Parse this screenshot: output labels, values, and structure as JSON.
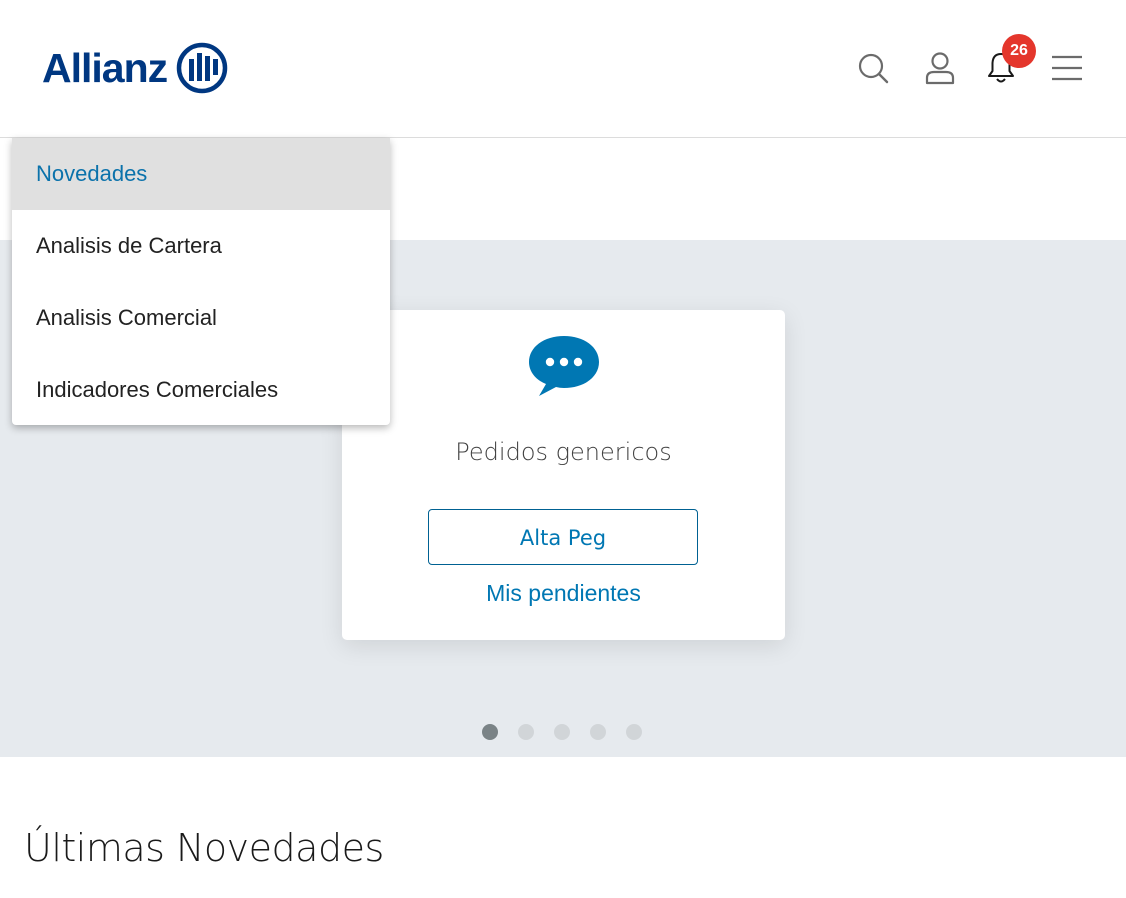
{
  "header": {
    "logo_text": "Allianz",
    "notification_count": "26",
    "icons": [
      "search-icon",
      "user-icon",
      "bell-icon",
      "hamburger-menu-icon"
    ]
  },
  "menu": {
    "items": [
      {
        "label": "Novedades",
        "selected": true
      },
      {
        "label": "Analisis de Cartera",
        "selected": false
      },
      {
        "label": "Analisis Comercial",
        "selected": false
      },
      {
        "label": "Indicadores Comerciales",
        "selected": false
      }
    ]
  },
  "carousel": {
    "card": {
      "icon": "chat-bubble-icon",
      "title": "Pedidos genericos",
      "button_label": "Alta Peg",
      "link_label": "Mis pendientes"
    },
    "slide_count": 5,
    "active_slide": 1
  },
  "section": {
    "title": "Últimas Novedades"
  },
  "colors": {
    "brand": "#003781",
    "accent": "#0077b3",
    "badge": "#e4362c",
    "hero_bg": "#e6eaee",
    "selected_bg": "#e0e0e0"
  }
}
